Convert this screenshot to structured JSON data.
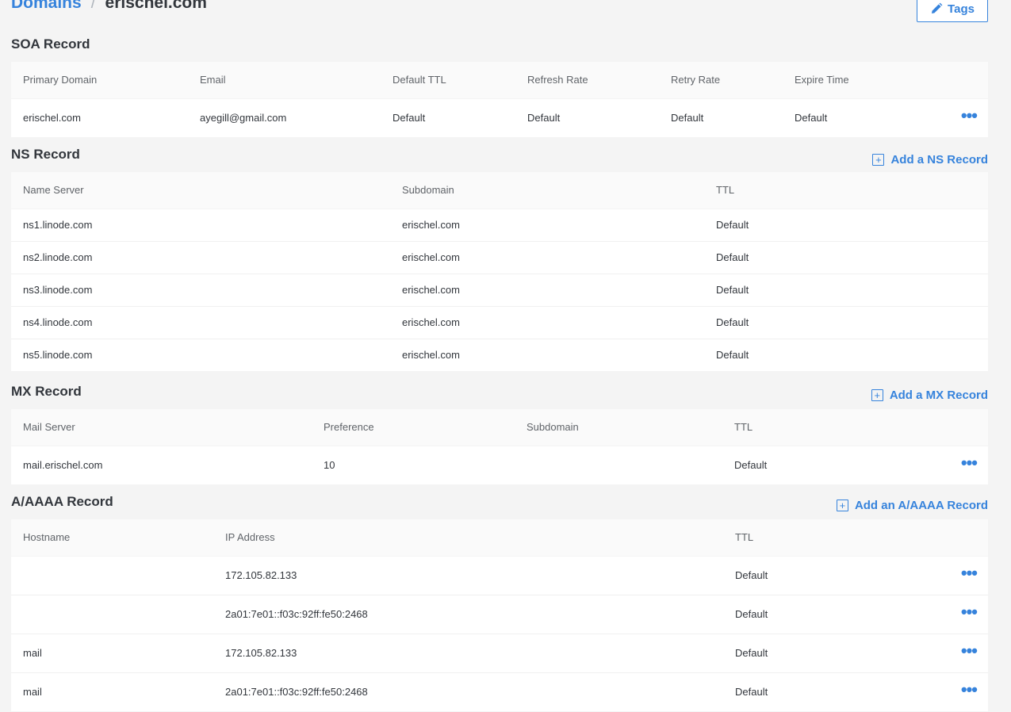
{
  "breadcrumb": {
    "parent": "Domains",
    "separator": "/",
    "current": "erischel.com"
  },
  "tags_button": {
    "label": "Tags"
  },
  "soa": {
    "title": "SOA Record",
    "columns": [
      "Primary Domain",
      "Email",
      "Default TTL",
      "Refresh Rate",
      "Retry Rate",
      "Expire Time"
    ],
    "rows": [
      [
        "erischel.com",
        "ayegill@gmail.com",
        "Default",
        "Default",
        "Default",
        "Default"
      ]
    ]
  },
  "ns": {
    "title": "NS Record",
    "add_label": "Add a NS Record",
    "columns": [
      "Name Server",
      "Subdomain",
      "TTL"
    ],
    "rows": [
      [
        "ns1.linode.com",
        "erischel.com",
        "Default"
      ],
      [
        "ns2.linode.com",
        "erischel.com",
        "Default"
      ],
      [
        "ns3.linode.com",
        "erischel.com",
        "Default"
      ],
      [
        "ns4.linode.com",
        "erischel.com",
        "Default"
      ],
      [
        "ns5.linode.com",
        "erischel.com",
        "Default"
      ]
    ]
  },
  "mx": {
    "title": "MX Record",
    "add_label": "Add a MX Record",
    "columns": [
      "Mail Server",
      "Preference",
      "Subdomain",
      "TTL"
    ],
    "rows": [
      [
        "mail.erischel.com",
        "10",
        "",
        "Default"
      ]
    ]
  },
  "a": {
    "title": "A/AAAA Record",
    "add_label": "Add an A/AAAA Record",
    "columns": [
      "Hostname",
      "IP Address",
      "TTL"
    ],
    "rows": [
      [
        "",
        "172.105.82.133",
        "Default"
      ],
      [
        "",
        "2a01:7e01::f03c:92ff:fe50:2468",
        "Default"
      ],
      [
        "mail",
        "172.105.82.133",
        "Default"
      ],
      [
        "mail",
        "2a01:7e01::f03c:92ff:fe50:2468",
        "Default"
      ]
    ]
  },
  "icons": {
    "tags": "pencil-icon",
    "add": "plus-box-icon",
    "actions": "ellipsis-icon"
  },
  "colors": {
    "accent": "#3683dc",
    "background": "#f4f4f4"
  }
}
